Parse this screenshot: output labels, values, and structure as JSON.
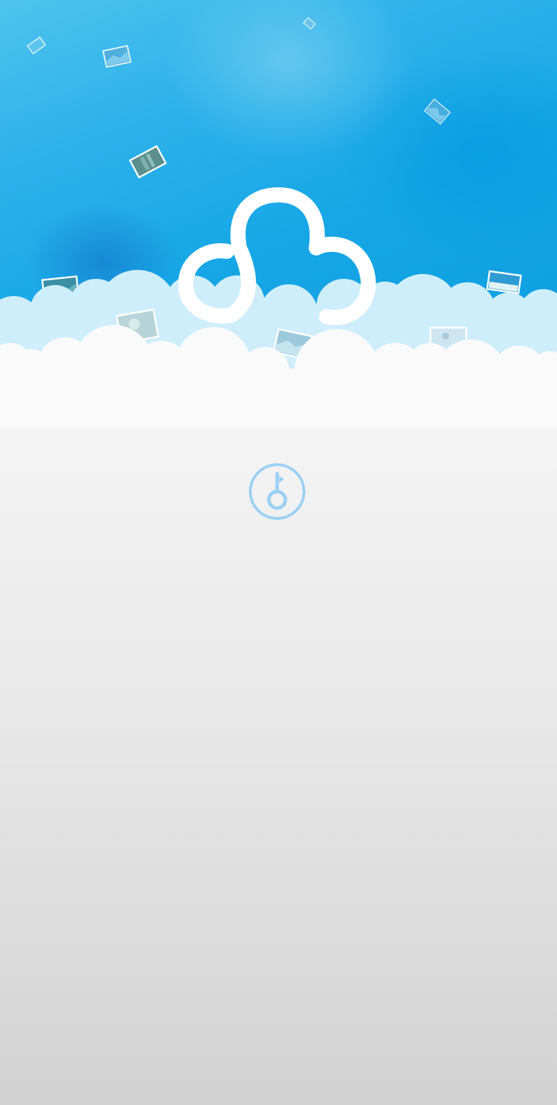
{
  "screen": {
    "background_top": "#fafafa",
    "background_bottom": "#d2d2d2",
    "sky_color": "#17a7e6"
  },
  "logo": {
    "icon": "cloud-logo-icon",
    "color": "#ffffff"
  },
  "unlock": {
    "icon": "key-icon",
    "color": "#9ad0f5"
  },
  "decor": {
    "icon": "photo-thumbnail-icon",
    "cloud_light": "#cfeefb",
    "cloud_white": "#fafafa"
  }
}
